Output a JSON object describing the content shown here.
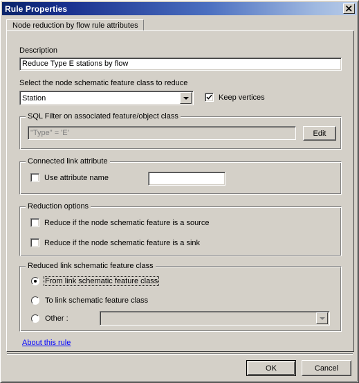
{
  "window": {
    "title": "Rule Properties",
    "close_icon": "close-icon"
  },
  "tabs": [
    {
      "label": "Node reduction by flow rule attributes",
      "active": true
    }
  ],
  "form": {
    "description_label": "Description",
    "description_value": "Reduce Type E stations by flow",
    "select_node_label": "Select the node schematic feature class to reduce",
    "node_feature_class_value": "Station",
    "keep_vertices_label": "Keep vertices",
    "keep_vertices_checked": "checked"
  },
  "sql_filter": {
    "group_title": "SQL Filter on associated feature/object class",
    "value": "\"Type\" = 'E'",
    "edit_button": "Edit"
  },
  "connected_link": {
    "group_title": "Connected link attribute",
    "use_attribute_label": "Use attribute name",
    "attribute_value": ""
  },
  "reduction_options": {
    "group_title": "Reduction options",
    "source_label": "Reduce if the node schematic feature is a source",
    "sink_label": "Reduce if the node schematic feature is a sink"
  },
  "reduced_link": {
    "group_title": "Reduced link schematic feature class",
    "from_label": "From link schematic feature class",
    "to_label": "To link schematic feature class",
    "other_label": "Other :",
    "other_value": ""
  },
  "footer": {
    "about_link": "About this rule",
    "ok_button": "OK",
    "cancel_button": "Cancel"
  },
  "colors": {
    "face": "#d4d0c8",
    "title_start": "#0a246a",
    "title_end": "#b8cbe8",
    "link": "#0000ff",
    "disabled_text": "#808080"
  }
}
